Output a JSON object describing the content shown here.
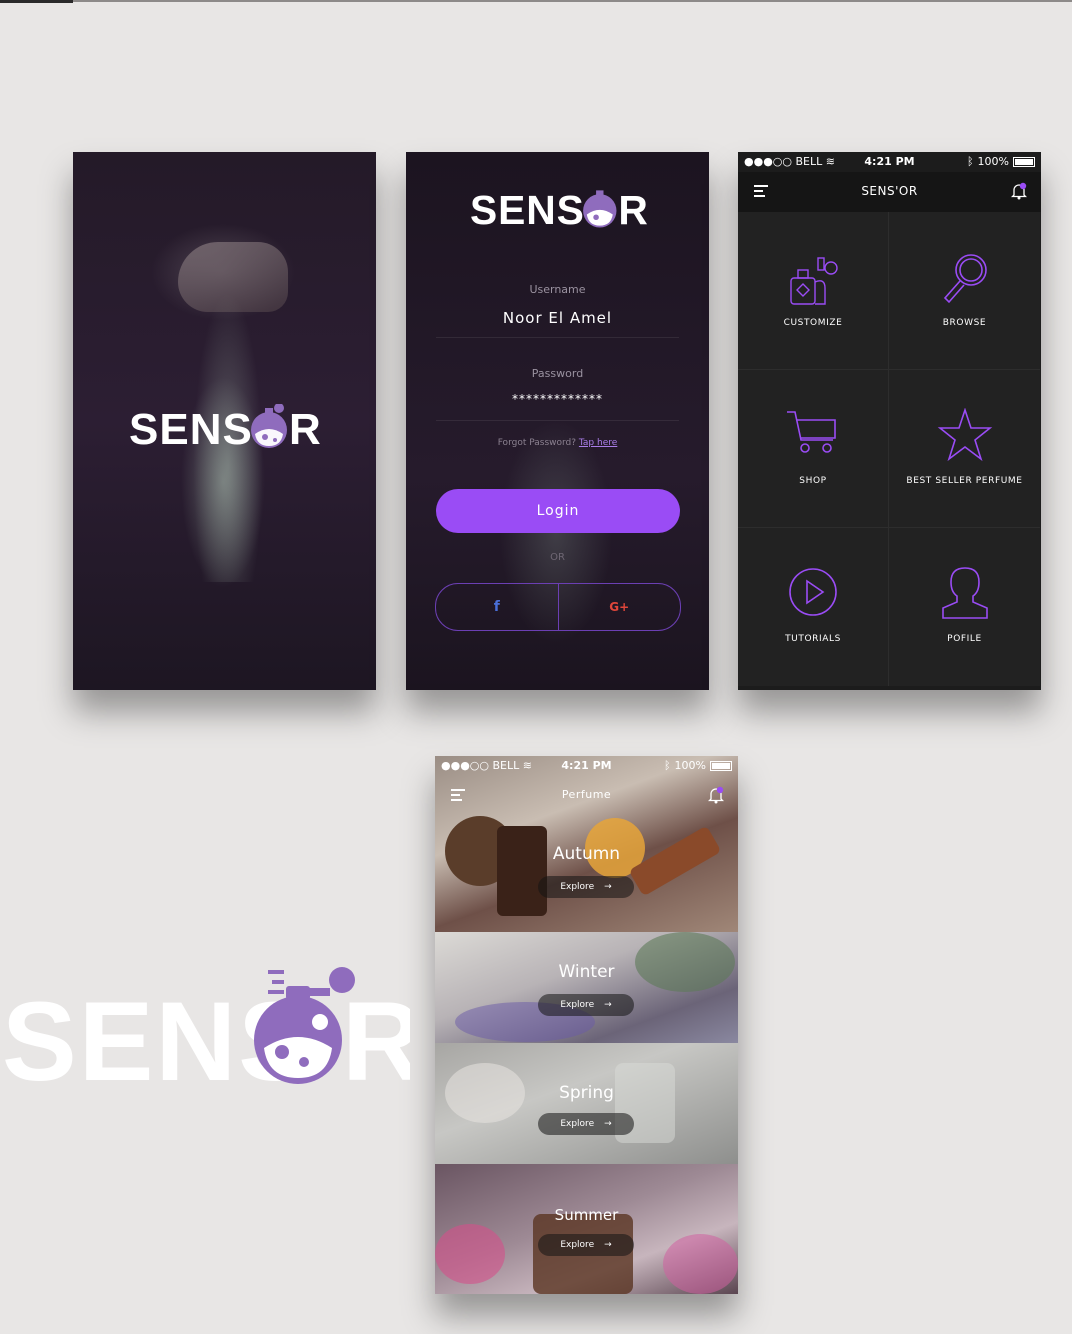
{
  "brand": {
    "logo_text": "SENSOR"
  },
  "login": {
    "username_label": "Username",
    "username_value": "Noor El Amel",
    "password_label": "Password",
    "password_value": "*************",
    "forgot_text": "Forgot Password?",
    "forgot_link": "Tap here",
    "login_button": "Login",
    "or_text": "OR",
    "facebook_icon": "f",
    "google_icon": "G+"
  },
  "status": {
    "carrier": "BELL",
    "time": "4:21 PM",
    "battery": "100%"
  },
  "menu": {
    "title": "SENS'OR",
    "items": [
      {
        "label": "CUSTOMIZE",
        "icon": "perfume-bottles-icon"
      },
      {
        "label": "BROWSE",
        "icon": "magnifier-icon"
      },
      {
        "label": "SHOP",
        "icon": "cart-icon"
      },
      {
        "label": "BEST SELLER PERFUME",
        "icon": "star-icon"
      },
      {
        "label": "TUTORIALS",
        "icon": "play-icon"
      },
      {
        "label": "POFILE",
        "icon": "person-icon"
      }
    ]
  },
  "perfume": {
    "title": "Perfume",
    "seasons": [
      {
        "name": "Autumn",
        "explore": "Explore"
      },
      {
        "name": "Winter",
        "explore": "Explore"
      },
      {
        "name": "Spring",
        "explore": "Explore"
      },
      {
        "name": "Summer",
        "explore": "Explore"
      }
    ]
  },
  "colors": {
    "accent": "#9a4cf5",
    "logo_purple": "#8f6cbd",
    "dark_bg": "#1c1c1c"
  }
}
